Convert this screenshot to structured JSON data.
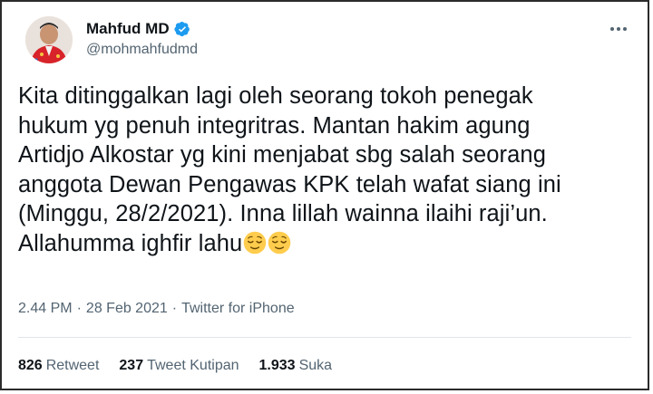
{
  "author": {
    "name": "Mahfud MD",
    "handle": "@mohmahfudmd",
    "verified": true,
    "verified_icon": "verified-badge-icon",
    "accent_color": "#1d9bf0"
  },
  "tweet": {
    "lines": [
      "Kita ditinggalkan lagi oleh seorang tokoh penegak",
      "hukum yg penuh integritras. Mantan hakim agung",
      "Artidjo Alkostar yg kini menjabat sbg salah seorang",
      "anggota Dewan Pengawas KPK telah wafat siang ini",
      "(Minggu, 28/2/2021). Inna lillah wainna ilaihi raji’un.",
      "Allahumma ighfir lahu"
    ],
    "emoji": [
      "relieved-face-icon",
      "relieved-face-icon"
    ]
  },
  "meta": {
    "time": "2.44 PM",
    "separator": "·",
    "date": "28 Feb 2021",
    "source": "Twitter for iPhone"
  },
  "stats": [
    {
      "count": "826",
      "label": "Retweet"
    },
    {
      "count": "237",
      "label": "Tweet Kutipan"
    },
    {
      "count": "1.933",
      "label": "Suka"
    }
  ],
  "colors": {
    "text": "#0f1419",
    "muted": "#536471",
    "divider": "#e1e6ea",
    "border": "#2b2b2b"
  }
}
